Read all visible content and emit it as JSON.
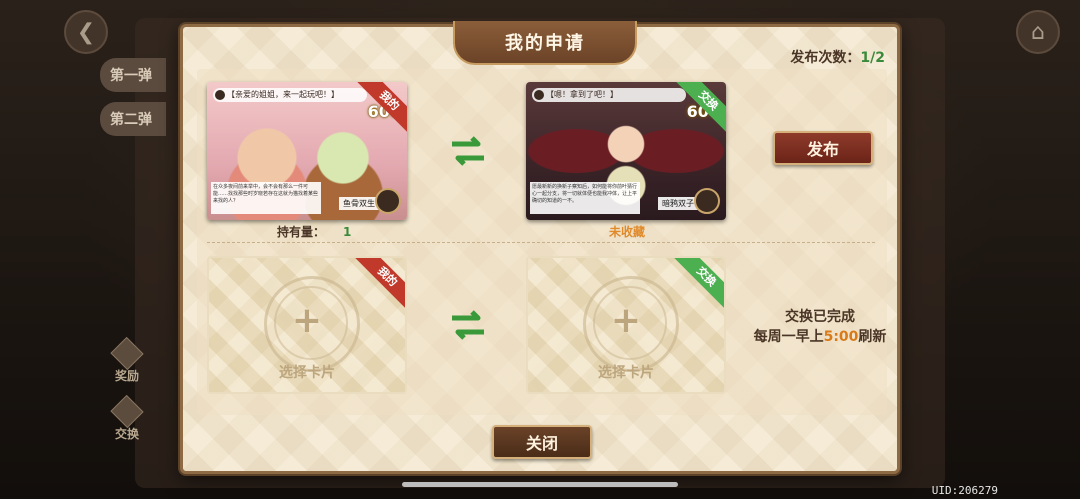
{
  "dialog": {
    "title": "我的申请",
    "publish_count_label": "发布次数：",
    "publish_count_value": "1/2"
  },
  "background": {
    "side_tabs": [
      "第一弹",
      "第二弹"
    ],
    "side_badges": [
      {
        "icon": "reward-icon",
        "label": "奖励"
      },
      {
        "icon": "exchange-icon",
        "label": "交换"
      }
    ]
  },
  "offer_row": {
    "my_card": {
      "ribbon": "我的",
      "title": "【亲爱的姐姐，来一起玩吧！】",
      "price": "600",
      "name": "鱼骨双生",
      "description": "在众多夜间前来举中，会不会有那么一件可能……找找那些时岁晓若存在这就为猫找着某些来找的人？"
    },
    "own_label": "持有量：",
    "own_value": "1",
    "target_card": {
      "ribbon": "交换",
      "title": "【嗯！拿到了吧！】",
      "price": "600",
      "name": "暗鸦双子",
      "description": "愿最新新的换新子察知后，如何能将你前叶猜行心一起分支，将一切就体便也能我冲体，让上平确切的知道的一不。"
    },
    "status_label": "未收藏",
    "publish_button": "发布"
  },
  "empty_row": {
    "my_slot": {
      "ribbon": "我的",
      "label": "选择卡片"
    },
    "target_slot": {
      "ribbon": "交换",
      "label": "选择卡片"
    },
    "message_line1": "交换已完成",
    "message_line2_prefix": "每周一早上",
    "message_line2_time": "5:00",
    "message_line2_suffix": "刷新"
  },
  "close_button": "关闭",
  "uid": "UID:206279",
  "colors": {
    "accent_green": "#3b8a3b",
    "accent_orange": "#e08a2a",
    "button_red": "#8e3a2a",
    "ribbon_red": "#c0392b",
    "ribbon_green": "#4caf50"
  }
}
